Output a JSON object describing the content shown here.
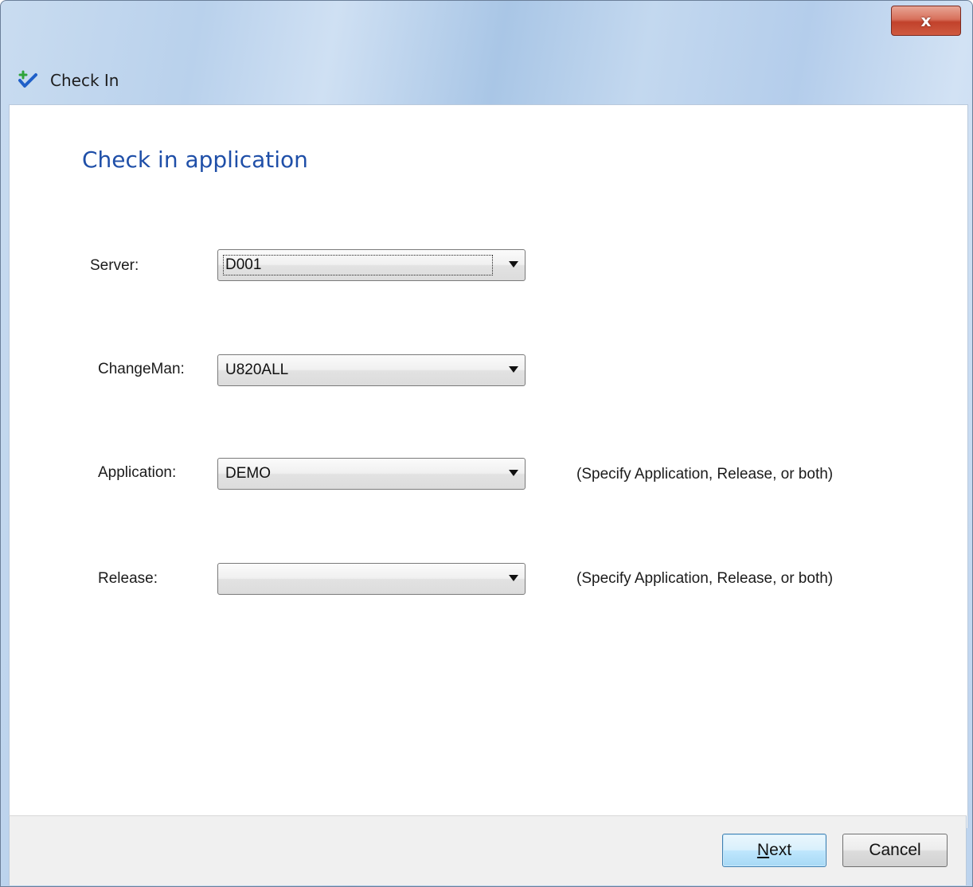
{
  "window": {
    "title": "Check In",
    "close_label": "x"
  },
  "page": {
    "heading": "Check in application"
  },
  "fields": {
    "server": {
      "label": "Server:",
      "value": "D001"
    },
    "changeman": {
      "label": "ChangeMan:",
      "value": "U820ALL"
    },
    "application": {
      "label": "Application:",
      "value": "DEMO",
      "hint": "(Specify Application, Release, or both)"
    },
    "release": {
      "label": "Release:",
      "value": "",
      "hint": "(Specify Application, Release, or both)"
    }
  },
  "buttons": {
    "next_mnemonic": "N",
    "next_rest": "ext",
    "cancel_label": "Cancel"
  },
  "icons": {
    "title_icon": "check-in-icon",
    "dropdown_icon": "chevron-down-icon"
  },
  "colors": {
    "heading": "#1f4fa8",
    "close_button": "#c1412b",
    "default_button_border": "#3c7fb1"
  }
}
